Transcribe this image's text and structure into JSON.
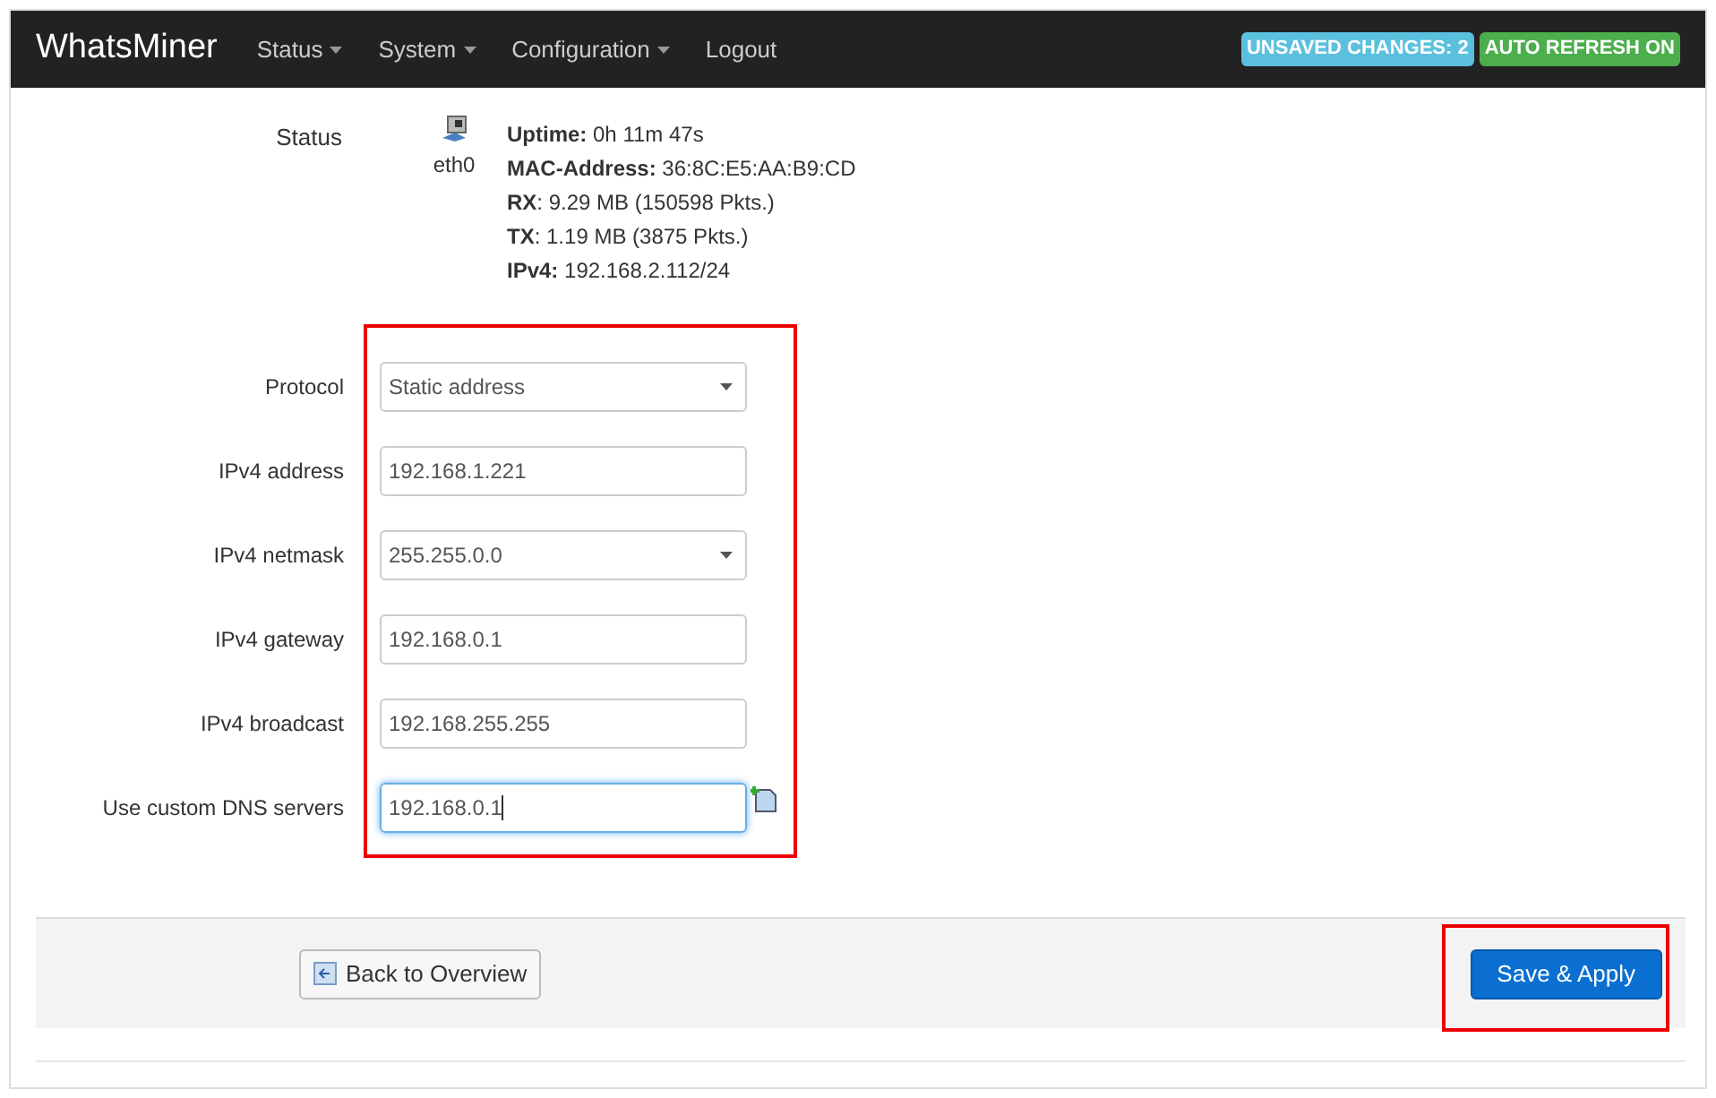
{
  "navbar": {
    "brand": "WhatsMiner",
    "menu": [
      {
        "label": "Status",
        "dropdown": true
      },
      {
        "label": "System",
        "dropdown": true
      },
      {
        "label": "Configuration",
        "dropdown": true
      },
      {
        "label": "Logout",
        "dropdown": false
      }
    ],
    "badges": [
      {
        "text": "UNSAVED CHANGES: 2",
        "color": "#5bc0de"
      },
      {
        "text": "AUTO REFRESH ON",
        "color": "#4cae4c"
      }
    ]
  },
  "status": {
    "label": "Status",
    "interface": "eth0",
    "details": [
      "**Uptime:** 0h 11m 47s",
      "**MAC-Address:** 36:8C:E5:AA:B9:CD",
      "**RX**: 9.29 MB (150598 Pkts.)",
      "**TX**: 1.19 MB (3875 Pkts.)",
      "**IPv4:** 192.168.2.112/24"
    ]
  },
  "form": [
    {
      "label": "Protocol",
      "kind": "select",
      "value": "Static address",
      "focused": false
    },
    {
      "label": "IPv4 address",
      "kind": "input",
      "value": "192.168.1.221",
      "focused": false
    },
    {
      "label": "IPv4 netmask",
      "kind": "select",
      "value": "255.255.0.0",
      "focused": false
    },
    {
      "label": "IPv4 gateway",
      "kind": "input",
      "value": "192.168.0.1",
      "focused": false
    },
    {
      "label": "IPv4 broadcast",
      "kind": "input",
      "value": "192.168.255.255",
      "focused": false
    },
    {
      "label": "Use custom DNS servers",
      "kind": "input-add",
      "value": "192.168.0.1",
      "focused": true
    }
  ],
  "footer": {
    "back_button": "Back to Overview",
    "apply_button": "Save & Apply"
  }
}
